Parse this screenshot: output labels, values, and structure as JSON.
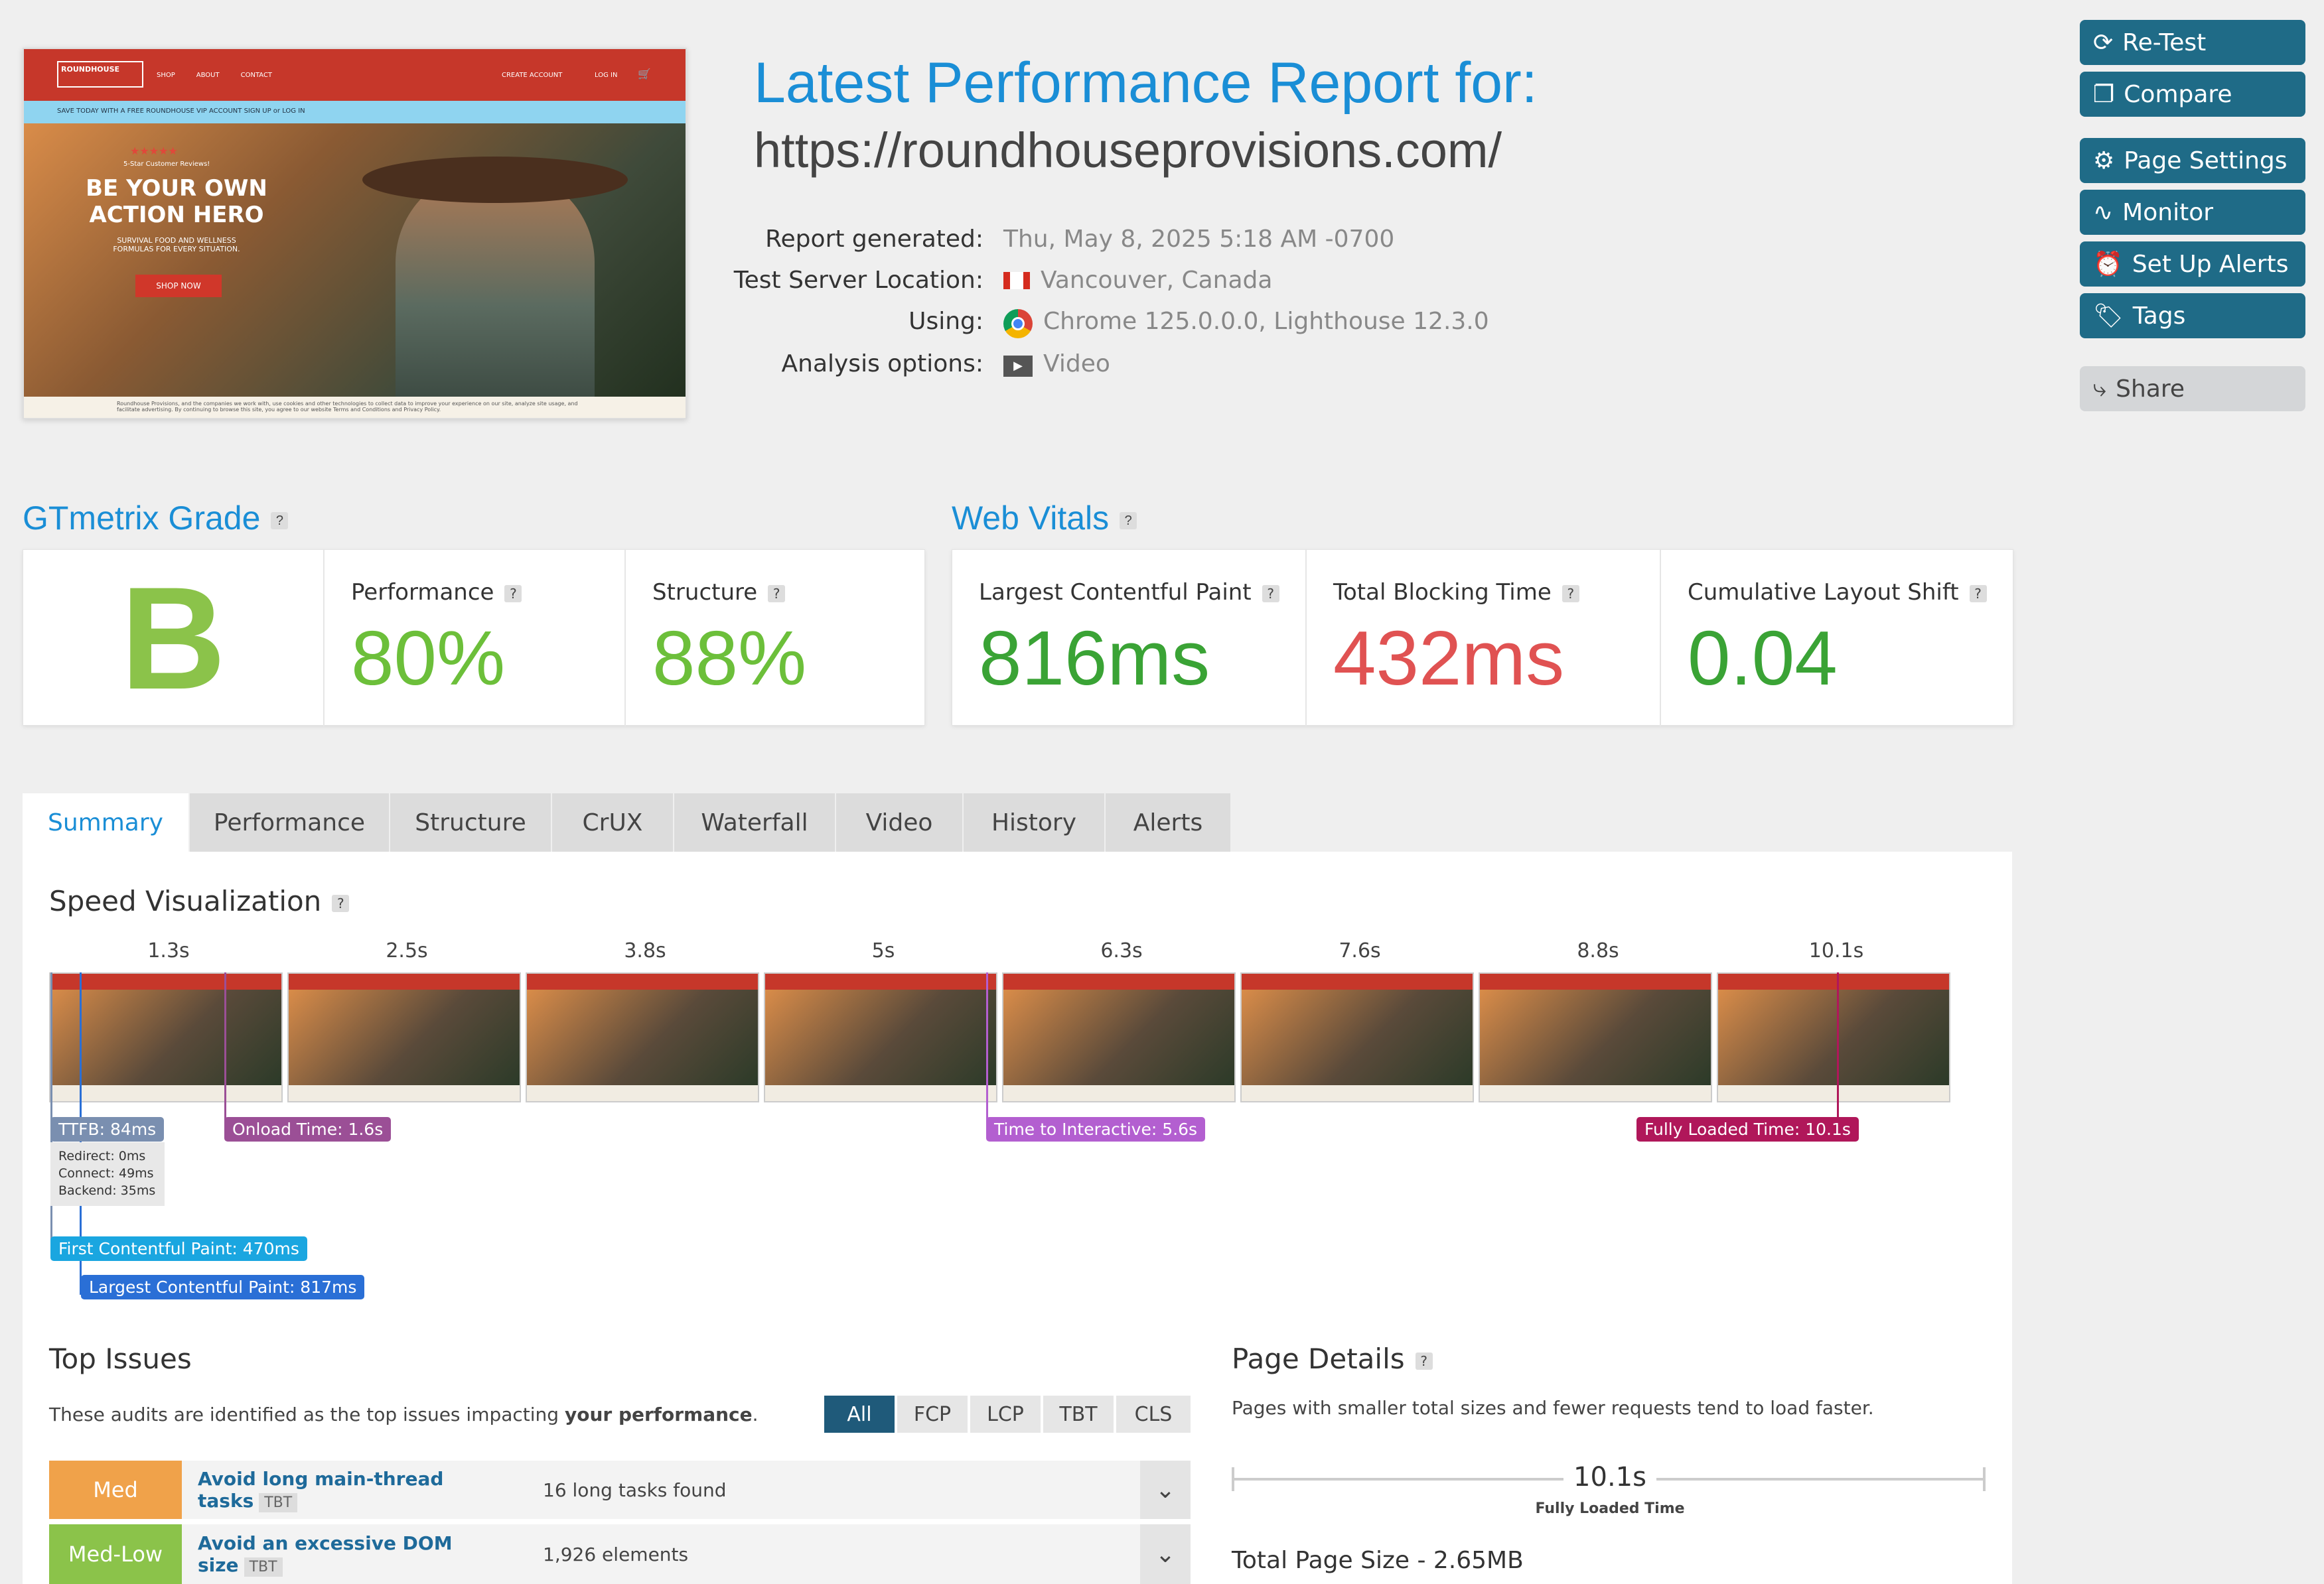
{
  "hero": {
    "nav_brand": "ROUNDHOUSE",
    "nav_links": [
      "SHOP",
      "ABOUT",
      "CONTACT"
    ],
    "nav_account": "CREATE ACCOUNT",
    "nav_login": "LOG IN",
    "promo": "SAVE TODAY WITH A FREE ROUNDHOUSE VIP ACCOUNT SIGN UP or LOG IN",
    "stars": "★★★★★",
    "reviews": "5-Star Customer Reviews!",
    "headline": "BE YOUR OWN ACTION HERO",
    "sub": "SURVIVAL FOOD AND WELLNESS FORMULAS FOR EVERY SITUATION.",
    "cta": "SHOP NOW",
    "cookie": "Roundhouse Provisions, and the companies we work with, use cookies and other technologies to collect data to improve your experience on our site, analyze site usage, and facilitate advertising. By continuing to browse this site, you agree to our website Terms and Conditions and Privacy Policy."
  },
  "header": {
    "title": "Latest Performance Report for:",
    "url": "https://roundhouseprovisions.com/"
  },
  "meta": {
    "generated_label": "Report generated:",
    "generated": "Thu, May 8, 2025 5:18 AM -0700",
    "location_label": "Test Server Location:",
    "location": "Vancouver, Canada",
    "using_label": "Using:",
    "using": "Chrome 125.0.0.0, Lighthouse 12.3.0",
    "options_label": "Analysis options:",
    "options": "Video"
  },
  "sidebar": {
    "retest": "Re-Test",
    "compare": "Compare",
    "settings": "Page Settings",
    "monitor": "Monitor",
    "alerts": "Set Up Alerts",
    "tags": "Tags",
    "share": "Share"
  },
  "grade": {
    "title": "GTmetrix Grade",
    "letter": "B",
    "perf_label": "Performance",
    "perf": "80%",
    "struct_label": "Structure",
    "struct": "88%"
  },
  "vitals": {
    "title": "Web Vitals",
    "lcp_label": "Largest Contentful Paint",
    "lcp": "816ms",
    "tbt_label": "Total Blocking Time",
    "tbt": "432ms",
    "cls_label": "Cumulative Layout Shift",
    "cls": "0.04"
  },
  "tabs": [
    "Summary",
    "Performance",
    "Structure",
    "CrUX",
    "Waterfall",
    "Video",
    "History",
    "Alerts"
  ],
  "speed": {
    "title": "Speed Visualization",
    "times": [
      "1.3s",
      "2.5s",
      "3.8s",
      "5s",
      "6.3s",
      "7.6s",
      "8.8s",
      "10.1s"
    ],
    "ttfb": "TTFB: 84ms",
    "redirect": "Redirect: 0ms",
    "connect": "Connect: 49ms",
    "backend": "Backend: 35ms",
    "onload": "Onload Time: 1.6s",
    "tti": "Time to Interactive: 5.6s",
    "fully": "Fully Loaded Time: 10.1s",
    "fcp": "First Contentful Paint: 470ms",
    "lcp": "Largest Contentful Paint: 817ms"
  },
  "issues": {
    "title": "Top Issues",
    "desc_pre": "These audits are identified as the top issues impacting ",
    "desc_bold": "your performance",
    "desc_post": ".",
    "filters": [
      "All",
      "FCP",
      "LCP",
      "TBT",
      "CLS"
    ],
    "rows": [
      {
        "badge": "Med",
        "name": "Avoid long main-thread tasks",
        "tag": "TBT",
        "detail": "16 long tasks found",
        "color": "#f0a24a"
      },
      {
        "badge": "Med-Low",
        "name": "Avoid an excessive DOM size",
        "tag": "TBT",
        "detail": "1,926 elements",
        "color": "#8bc34a"
      }
    ]
  },
  "details": {
    "title": "Page Details",
    "desc": "Pages with smaller total sizes and fewer requests tend to load faster.",
    "fully_val": "10.1s",
    "fully_label": "Fully Loaded Time",
    "size": "Total Page Size - 2.65MB"
  },
  "colors": {
    "accent": "#1a8ed6",
    "button": "#1f6b87",
    "good": "#3aa335",
    "bad": "#e05252",
    "grade": "#8bc34a"
  }
}
